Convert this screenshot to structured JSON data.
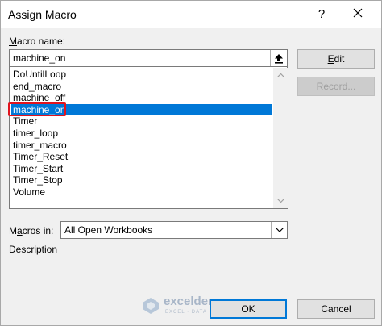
{
  "window": {
    "title": "Assign Macro",
    "help_label": "?",
    "close_icon": "close-icon"
  },
  "macro_name": {
    "label_prefix": "M",
    "label_rest": "acro name:",
    "value": "machine_on"
  },
  "macro_list": {
    "items": [
      "DoUntilLoop",
      "end_macro",
      "machine_off",
      "machine_on",
      "Timer",
      "timer_loop",
      "timer_macro",
      "Timer_Reset",
      "Timer_Start",
      "Timer_Stop",
      "Volume"
    ],
    "selected": "machine_on"
  },
  "buttons": {
    "edit_prefix": "E",
    "edit_rest": "dit",
    "record": "Record...",
    "ok": "OK",
    "cancel": "Cancel"
  },
  "macros_in": {
    "label_prefix": "M",
    "label_middle": "a",
    "label_rest": "cros in:",
    "value": "All Open Workbooks"
  },
  "description": {
    "label": "Description"
  },
  "watermark": {
    "brand": "exceldemy",
    "tagline": "EXCEL · DATA · BI"
  },
  "colors": {
    "selection": "#0078d7",
    "highlight": "#e0141e"
  }
}
